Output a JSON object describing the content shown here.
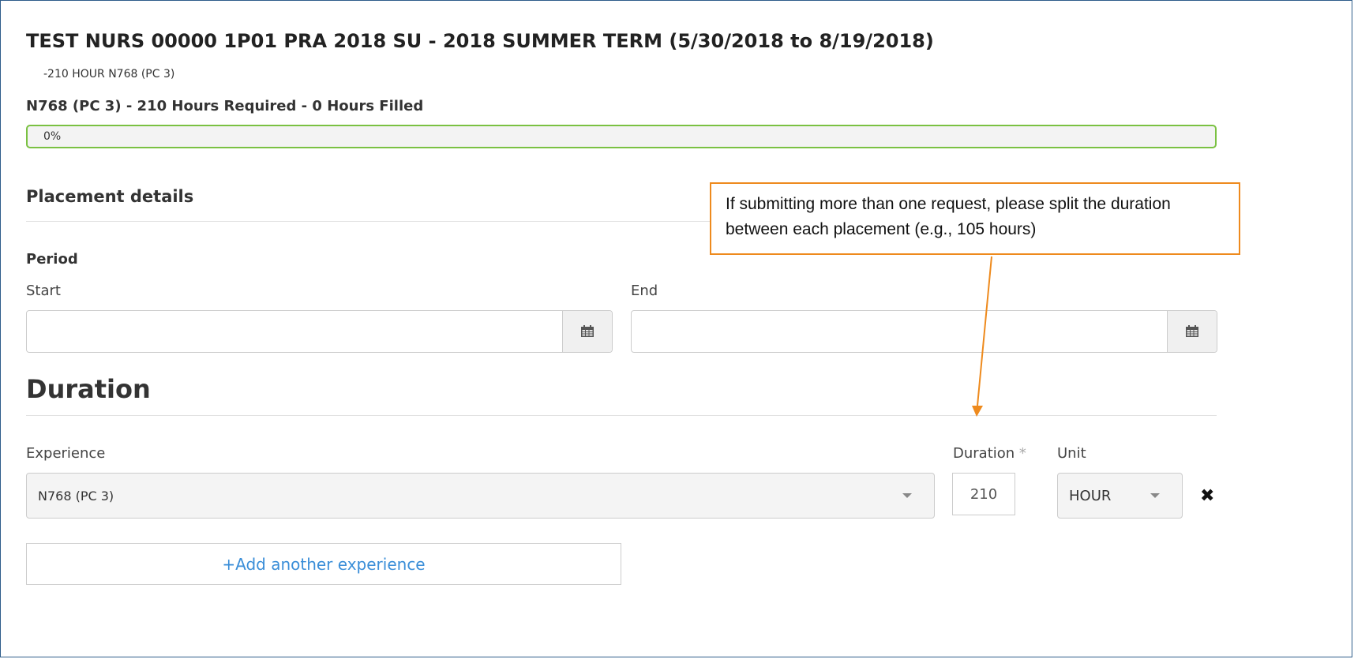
{
  "course": {
    "title": "TEST NURS 00000 1P01 PRA 2018 SU - 2018 SUMMER TERM (5/30/2018 to 8/19/2018)",
    "subtitle": "-210 HOUR N768 (PC 3)",
    "requirement": "N768 (PC 3) - 210 Hours Required - 0 Hours Filled"
  },
  "progress": {
    "label": "0%",
    "value": 0,
    "color": "#7ac142"
  },
  "placement": {
    "heading": "Placement details",
    "period_label": "Period",
    "start_label": "Start",
    "end_label": "End",
    "start_value": "",
    "end_value": ""
  },
  "duration_section": {
    "heading": "Duration",
    "experience_label": "Experience",
    "experience_value": "N768 (PC 3)",
    "duration_label": "Duration",
    "required_mark": "*",
    "duration_value": "210",
    "unit_label": "Unit",
    "unit_value": "HOUR",
    "remove_icon": "close-icon",
    "add_label": "+Add another experience"
  },
  "callout": {
    "text": "If submitting more than one request, please split the duration between each placement (e.g., 105 hours)",
    "color": "#ee8a1d"
  },
  "icons": {
    "calendar": "calendar-icon",
    "dropdown": "chevron-down-icon"
  }
}
